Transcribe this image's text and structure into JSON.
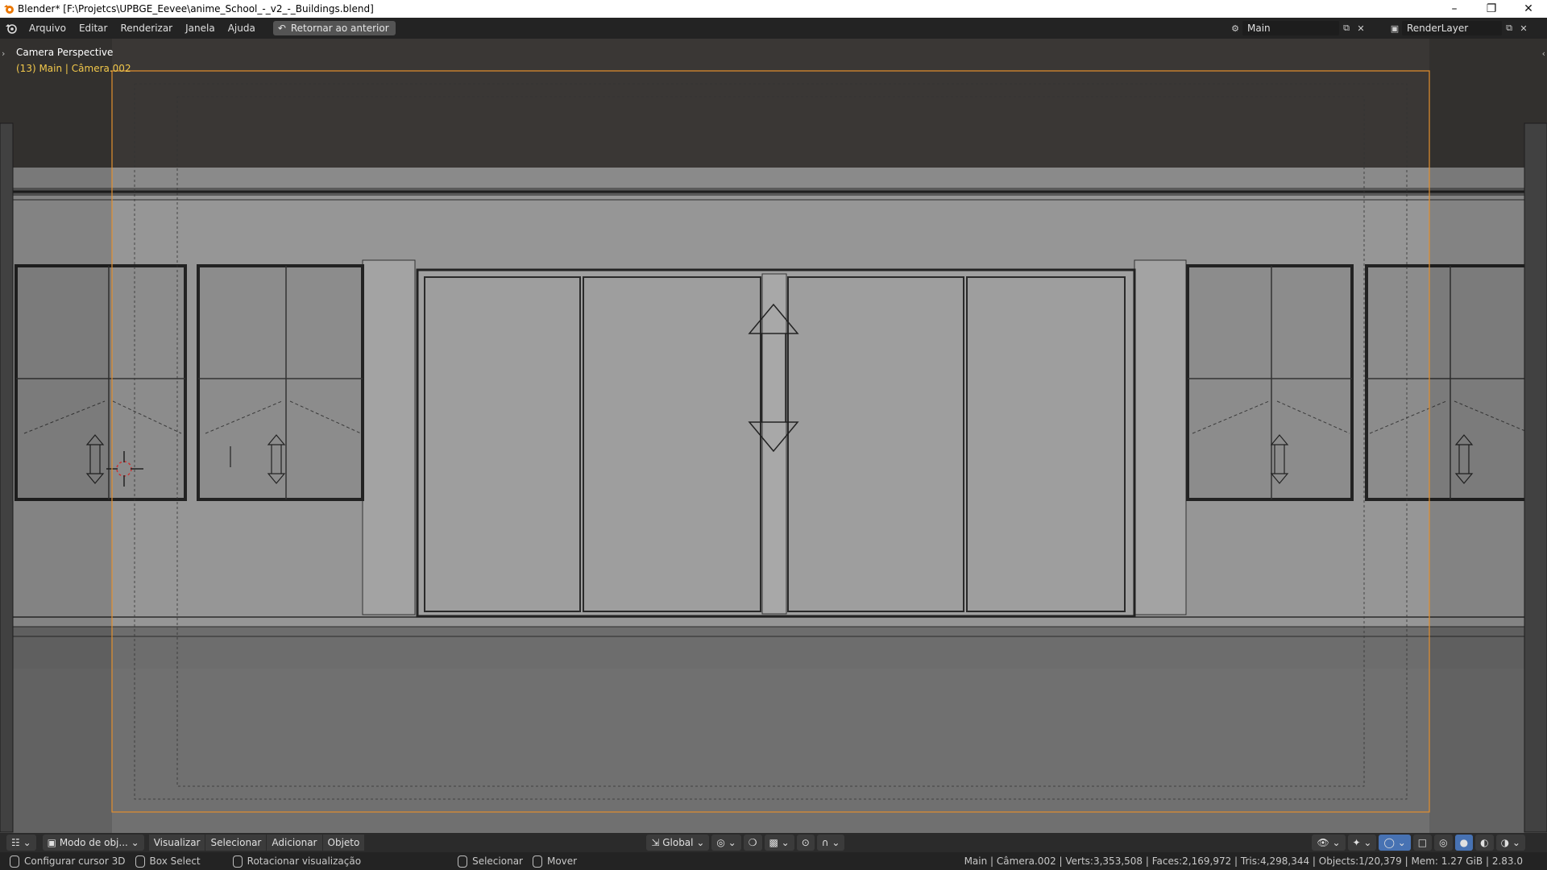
{
  "window": {
    "title": "Blender* [F:\\Projetcs\\UPBGE_Eevee\\anime_School_-_v2_-_Buildings.blend]",
    "controls": [
      "minimize-icon",
      "restore-icon",
      "close-icon"
    ]
  },
  "menu": {
    "items": [
      "Arquivo",
      "Editar",
      "Renderizar",
      "Janela",
      "Ajuda"
    ],
    "back_button": "Retornar ao anterior"
  },
  "scene": {
    "name": "Main"
  },
  "view_layer": {
    "name": "RenderLayer"
  },
  "viewport": {
    "view_name": "Camera Perspective",
    "object_info": "(13) Main | Câmera.002"
  },
  "viewport_header": {
    "mode": "Modo de obj...",
    "menus": [
      "Visualizar",
      "Selecionar",
      "Adicionar",
      "Objeto"
    ],
    "orientation": "Global"
  },
  "statusbar": {
    "hints": [
      {
        "icon": "mouse-left-icon",
        "label": "Configurar cursor 3D"
      },
      {
        "icon": "mouse-left-icon",
        "label": "Box Select"
      },
      {
        "icon": "mouse-middle-icon",
        "label": "Rotacionar visualização"
      },
      {
        "icon": "mouse-left-icon",
        "label": "Selecionar"
      },
      {
        "icon": "mouse-right-icon",
        "label": "Mover"
      }
    ],
    "stats": "Main | Câmera.002 | Verts:3,353,508 | Faces:2,169,972 | Tris:4,298,344 | Objects:1/20,379 | Mem: 1.27 GiB | 2.83.0"
  },
  "colors": {
    "accent": "#4772b3",
    "camera_frame": "#e38f2e",
    "object_info": "#f2c84b"
  }
}
